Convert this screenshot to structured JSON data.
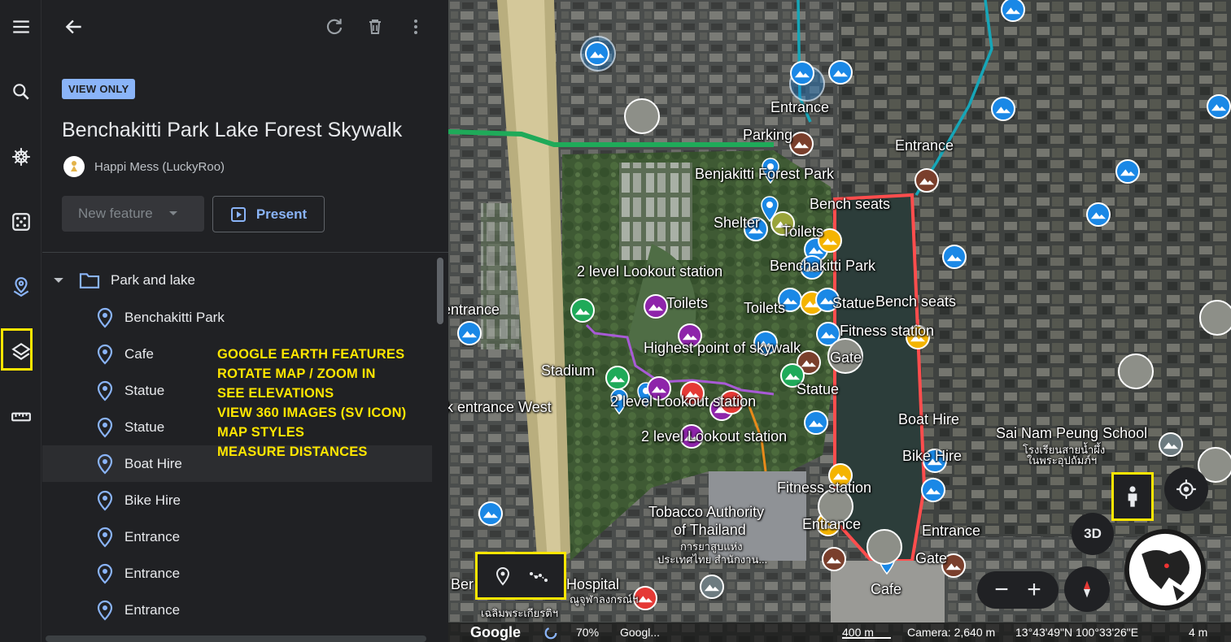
{
  "panel": {
    "view_only_badge": "VIEW ONLY",
    "project_title": "Benchakitti Park Lake Forest Skywalk",
    "author": "Happi Mess (LuckyRoo)",
    "new_feature_label": "New feature",
    "present_label": "Present",
    "folder_name": "Park and lake",
    "features": [
      {
        "label": "Benchakitti Park"
      },
      {
        "label": "Cafe"
      },
      {
        "label": "Statue"
      },
      {
        "label": "Statue"
      },
      {
        "label": "Boat Hire"
      },
      {
        "label": "Bike Hire"
      },
      {
        "label": "Entrance"
      },
      {
        "label": "Entrance"
      },
      {
        "label": "Entrance"
      }
    ],
    "annotation_lines": [
      "GOOGLE EARTH FEATURES",
      "ROTATE MAP / ZOOM IN",
      "SEE ELEVATIONS",
      "VIEW 360 IMAGES (SV ICON)",
      "MAP STYLES",
      "MEASURE DISTANCES"
    ]
  },
  "map": {
    "labels": {
      "entrance_top": "Entrance",
      "parking": "Parking",
      "entrance_right": "Entrance",
      "forest_park": "Benjakitti Forest Park",
      "bench_seats_1": "Bench seats",
      "shelter": "Shelter",
      "toilets_1": "Toilets",
      "benchakitti_park": "Benchakitti Park",
      "lookout_1": "2 level Lookout station",
      "skywalk_entrance": "Skywalk entrance",
      "toilets_2": "Toilets",
      "toilets_3": "Toilets",
      "statue_1": "Statue",
      "bench_seats_2": "Bench seats",
      "fitness_1": "Fitness station",
      "highest_point": "Highest point of skywalk",
      "gate_1": "Gate",
      "stadium": "Stadium",
      "skywalk_entrance_west": "Skywalk entrance West",
      "lookout_2": "2 level Lookout station",
      "statue_2": "Statue",
      "boat_hire": "Boat Hire",
      "lookout_3": "2 level Lookout station",
      "bike_hire": "Bike Hire",
      "school": "Sai Nam Peung School",
      "school_thai_1": "โรงเรียนสายน้ำผึ้ง",
      "school_thai_2": "ในพระอุปถัมภ์ฯ",
      "fitness_2": "Fitness station",
      "tobacco_1": "Tobacco Authority",
      "tobacco_2": "of Thailand",
      "tobacco_thai_1": "การยาสูบแห่ง",
      "tobacco_thai_2": "ประเทศไทย สำนักงาน...",
      "entrance_bottom": "Entrance",
      "entrance_bottom_right": "Entrance",
      "gate_2": "Gate",
      "cafe": "Cafe",
      "hospital": "Hospital",
      "hospital_prefix": "Ber",
      "hospital_thai": "ณูจุฬาลงกรณ์ฯ",
      "hospital_thai_2": "เฉลิมพระเกียรติฯ"
    },
    "controls": {
      "three_d": "3D"
    },
    "status": {
      "google_logo": "Google",
      "zoom_percent": "70%",
      "attribution": "Googl...",
      "scale": "400 m",
      "camera": "Camera: 2,640 m",
      "coords": "13°43'49\"N 100°33'26\"E",
      "elevation": "4 m"
    }
  },
  "colors": {
    "accent_blue": "#8ab4f8",
    "highlight_yellow": "#ffe600",
    "park_outline_red": "#ff4d4d",
    "route_green": "#1faa59",
    "route_teal": "#16a6b8",
    "route_purple": "#a85ad6",
    "route_orange": "#e88a1a"
  }
}
